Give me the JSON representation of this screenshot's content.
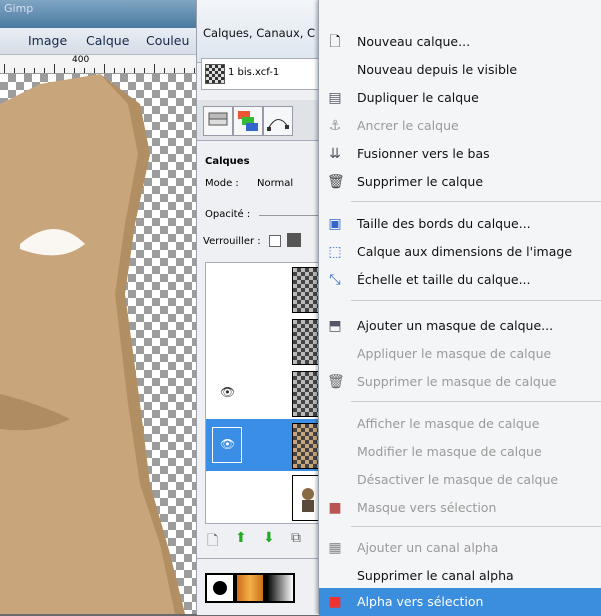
{
  "left_window": {
    "title": "Gimp",
    "menus": [
      "Image",
      "Calque",
      "Couleu"
    ],
    "ruler_label": "400"
  },
  "dock": {
    "title": "Calques, Canaux, C",
    "image_combo": "1 bis.xcf-1",
    "section_title": "Calques",
    "mode_label": "Mode :",
    "mode_value": "Normal",
    "opacity_label": "Opacité :",
    "lock_label": "Verrouiller :"
  },
  "menu": {
    "items": [
      {
        "label": "Nouveau calque...",
        "icon": "new-layer-icon",
        "enabled": true
      },
      {
        "label": "Nouveau depuis le visible",
        "icon": "",
        "enabled": true
      },
      {
        "label": "Dupliquer le calque",
        "icon": "duplicate-icon",
        "enabled": true
      },
      {
        "label": "Ancrer le calque",
        "icon": "anchor-icon",
        "enabled": false
      },
      {
        "label": "Fusionner vers le bas",
        "icon": "merge-down-icon",
        "enabled": true
      },
      {
        "label": "Supprimer le calque",
        "icon": "trash-icon",
        "enabled": true
      },
      {
        "label": "Taille des bords du calque...",
        "icon": "layer-boundary-icon",
        "enabled": true
      },
      {
        "label": "Calque aux dimensions de l'image",
        "icon": "layer-to-image-icon",
        "enabled": true
      },
      {
        "label": "Échelle et taille du calque...",
        "icon": "scale-layer-icon",
        "enabled": true
      },
      {
        "label": "Ajouter un masque de calque...",
        "icon": "add-mask-icon",
        "enabled": true
      },
      {
        "label": "Appliquer le masque de calque",
        "icon": "",
        "enabled": false
      },
      {
        "label": "Supprimer le masque de calque",
        "icon": "trash-icon",
        "enabled": false
      },
      {
        "label": "Afficher le masque de calque",
        "icon": "",
        "enabled": false
      },
      {
        "label": "Modifier le masque de calque",
        "icon": "",
        "enabled": false
      },
      {
        "label": "Désactiver le masque de calque",
        "icon": "",
        "enabled": false
      },
      {
        "label": "Masque vers sélection",
        "icon": "mask-to-selection-icon",
        "enabled": false
      },
      {
        "label": "Ajouter un canal alpha",
        "icon": "alpha-channel-icon",
        "enabled": false
      },
      {
        "label": "Supprimer le canal alpha",
        "icon": "",
        "enabled": true
      },
      {
        "label": "Alpha vers sélection",
        "icon": "alpha-to-selection-icon",
        "enabled": true,
        "highlighted": true
      }
    ]
  },
  "colors": {
    "menu_highlight": "#3b8ede",
    "layer_selected": "#3a8ee6",
    "skin": "#c7a780"
  }
}
